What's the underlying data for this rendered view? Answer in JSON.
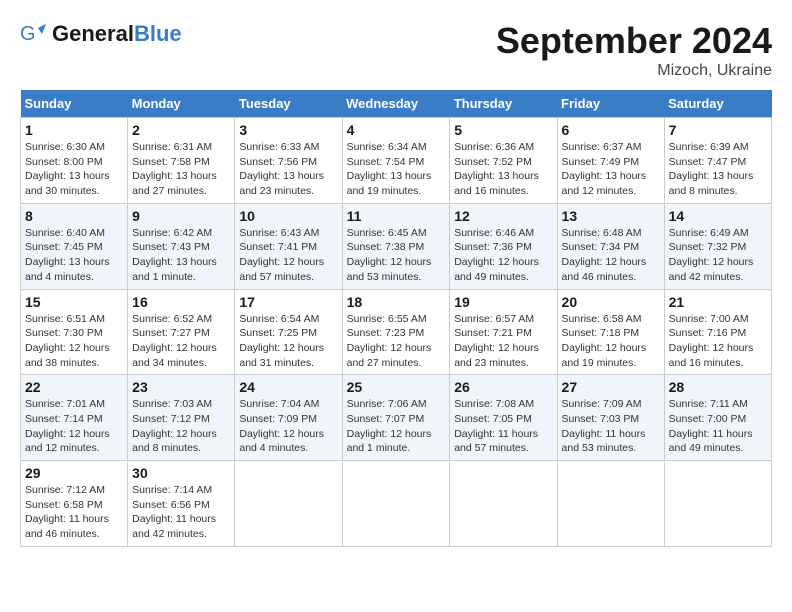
{
  "header": {
    "logo_line1": "General",
    "logo_line2": "Blue",
    "month": "September 2024",
    "location": "Mizoch, Ukraine"
  },
  "days_of_week": [
    "Sunday",
    "Monday",
    "Tuesday",
    "Wednesday",
    "Thursday",
    "Friday",
    "Saturday"
  ],
  "weeks": [
    [
      {
        "num": "1",
        "info": "Sunrise: 6:30 AM\nSunset: 8:00 PM\nDaylight: 13 hours\nand 30 minutes."
      },
      {
        "num": "2",
        "info": "Sunrise: 6:31 AM\nSunset: 7:58 PM\nDaylight: 13 hours\nand 27 minutes."
      },
      {
        "num": "3",
        "info": "Sunrise: 6:33 AM\nSunset: 7:56 PM\nDaylight: 13 hours\nand 23 minutes."
      },
      {
        "num": "4",
        "info": "Sunrise: 6:34 AM\nSunset: 7:54 PM\nDaylight: 13 hours\nand 19 minutes."
      },
      {
        "num": "5",
        "info": "Sunrise: 6:36 AM\nSunset: 7:52 PM\nDaylight: 13 hours\nand 16 minutes."
      },
      {
        "num": "6",
        "info": "Sunrise: 6:37 AM\nSunset: 7:49 PM\nDaylight: 13 hours\nand 12 minutes."
      },
      {
        "num": "7",
        "info": "Sunrise: 6:39 AM\nSunset: 7:47 PM\nDaylight: 13 hours\nand 8 minutes."
      }
    ],
    [
      {
        "num": "8",
        "info": "Sunrise: 6:40 AM\nSunset: 7:45 PM\nDaylight: 13 hours\nand 4 minutes."
      },
      {
        "num": "9",
        "info": "Sunrise: 6:42 AM\nSunset: 7:43 PM\nDaylight: 13 hours\nand 1 minute."
      },
      {
        "num": "10",
        "info": "Sunrise: 6:43 AM\nSunset: 7:41 PM\nDaylight: 12 hours\nand 57 minutes."
      },
      {
        "num": "11",
        "info": "Sunrise: 6:45 AM\nSunset: 7:38 PM\nDaylight: 12 hours\nand 53 minutes."
      },
      {
        "num": "12",
        "info": "Sunrise: 6:46 AM\nSunset: 7:36 PM\nDaylight: 12 hours\nand 49 minutes."
      },
      {
        "num": "13",
        "info": "Sunrise: 6:48 AM\nSunset: 7:34 PM\nDaylight: 12 hours\nand 46 minutes."
      },
      {
        "num": "14",
        "info": "Sunrise: 6:49 AM\nSunset: 7:32 PM\nDaylight: 12 hours\nand 42 minutes."
      }
    ],
    [
      {
        "num": "15",
        "info": "Sunrise: 6:51 AM\nSunset: 7:30 PM\nDaylight: 12 hours\nand 38 minutes."
      },
      {
        "num": "16",
        "info": "Sunrise: 6:52 AM\nSunset: 7:27 PM\nDaylight: 12 hours\nand 34 minutes."
      },
      {
        "num": "17",
        "info": "Sunrise: 6:54 AM\nSunset: 7:25 PM\nDaylight: 12 hours\nand 31 minutes."
      },
      {
        "num": "18",
        "info": "Sunrise: 6:55 AM\nSunset: 7:23 PM\nDaylight: 12 hours\nand 27 minutes."
      },
      {
        "num": "19",
        "info": "Sunrise: 6:57 AM\nSunset: 7:21 PM\nDaylight: 12 hours\nand 23 minutes."
      },
      {
        "num": "20",
        "info": "Sunrise: 6:58 AM\nSunset: 7:18 PM\nDaylight: 12 hours\nand 19 minutes."
      },
      {
        "num": "21",
        "info": "Sunrise: 7:00 AM\nSunset: 7:16 PM\nDaylight: 12 hours\nand 16 minutes."
      }
    ],
    [
      {
        "num": "22",
        "info": "Sunrise: 7:01 AM\nSunset: 7:14 PM\nDaylight: 12 hours\nand 12 minutes."
      },
      {
        "num": "23",
        "info": "Sunrise: 7:03 AM\nSunset: 7:12 PM\nDaylight: 12 hours\nand 8 minutes."
      },
      {
        "num": "24",
        "info": "Sunrise: 7:04 AM\nSunset: 7:09 PM\nDaylight: 12 hours\nand 4 minutes."
      },
      {
        "num": "25",
        "info": "Sunrise: 7:06 AM\nSunset: 7:07 PM\nDaylight: 12 hours\nand 1 minute."
      },
      {
        "num": "26",
        "info": "Sunrise: 7:08 AM\nSunset: 7:05 PM\nDaylight: 11 hours\nand 57 minutes."
      },
      {
        "num": "27",
        "info": "Sunrise: 7:09 AM\nSunset: 7:03 PM\nDaylight: 11 hours\nand 53 minutes."
      },
      {
        "num": "28",
        "info": "Sunrise: 7:11 AM\nSunset: 7:00 PM\nDaylight: 11 hours\nand 49 minutes."
      }
    ],
    [
      {
        "num": "29",
        "info": "Sunrise: 7:12 AM\nSunset: 6:58 PM\nDaylight: 11 hours\nand 46 minutes."
      },
      {
        "num": "30",
        "info": "Sunrise: 7:14 AM\nSunset: 6:56 PM\nDaylight: 11 hours\nand 42 minutes."
      },
      {
        "num": "",
        "info": ""
      },
      {
        "num": "",
        "info": ""
      },
      {
        "num": "",
        "info": ""
      },
      {
        "num": "",
        "info": ""
      },
      {
        "num": "",
        "info": ""
      }
    ]
  ]
}
